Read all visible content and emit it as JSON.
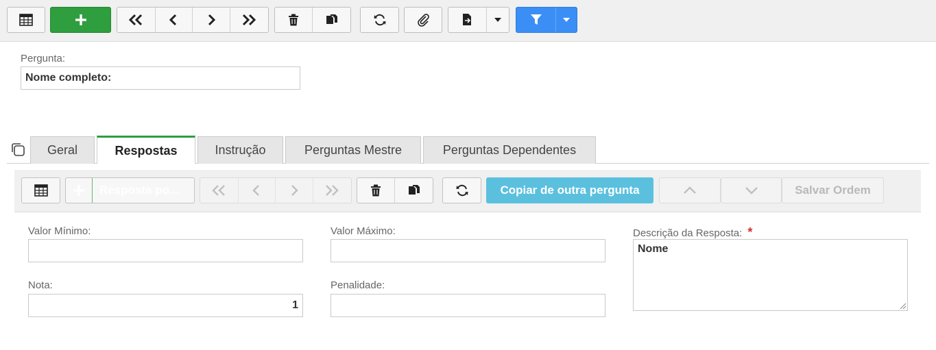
{
  "question": {
    "label": "Pergunta:",
    "value": "Nome completo:"
  },
  "tabs": [
    {
      "label": "Geral"
    },
    {
      "label": "Respostas"
    },
    {
      "label": "Instrução"
    },
    {
      "label": "Perguntas Mestre"
    },
    {
      "label": "Perguntas Dependentes"
    }
  ],
  "inner_toolbar": {
    "add_label": "Resposta po...",
    "copy_label": "Copiar de outra pergunta",
    "save_order_label": "Salvar Ordem"
  },
  "form": {
    "min_value": {
      "label": "Valor Mínimo:",
      "value": ""
    },
    "max_value": {
      "label": "Valor Máximo:",
      "value": ""
    },
    "description": {
      "label": "Descrição da Resposta:",
      "required_mark": "*",
      "value": "Nome"
    },
    "score": {
      "label": "Nota:",
      "value": "1"
    },
    "penalty": {
      "label": "Penalidade:",
      "value": ""
    }
  },
  "colors": {
    "green": "#2e9e3e",
    "blue": "#3a8ef6",
    "light_blue": "#5bc0de",
    "required": "#d9302c"
  }
}
